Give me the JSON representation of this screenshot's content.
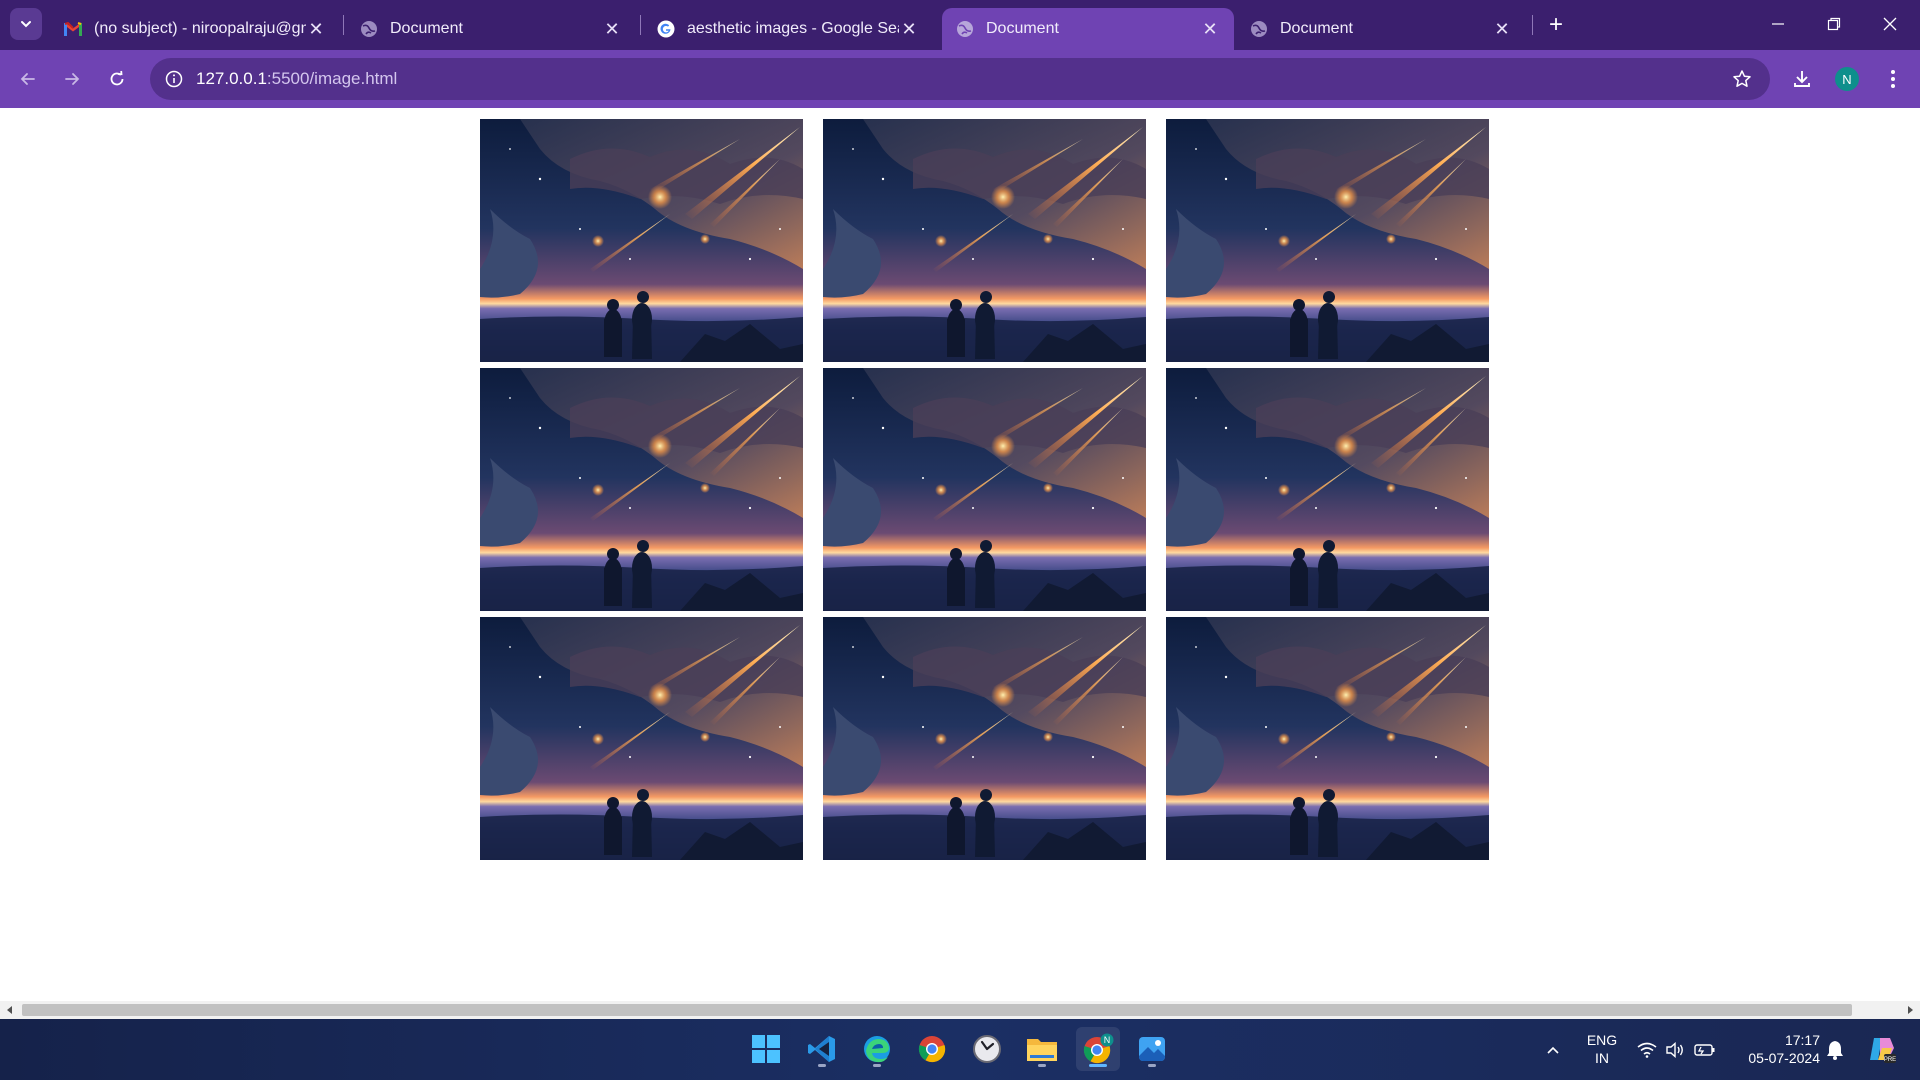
{
  "browser": {
    "tabs": [
      {
        "title": "(no subject) - niroopalraju@gm",
        "icon": "gmail-icon",
        "active": false
      },
      {
        "title": "Document",
        "icon": "globe-icon",
        "active": false
      },
      {
        "title": "aesthetic images - Google Sear",
        "icon": "google-icon",
        "active": false
      },
      {
        "title": "Document",
        "icon": "globe-icon",
        "active": true
      },
      {
        "title": "Document",
        "icon": "globe-icon",
        "active": false
      }
    ],
    "new_tab_glyph": "+",
    "close_glyph": "✕",
    "url_host": "127.0.0.1",
    "url_path": ":5500/image.html",
    "avatar_letter": "N",
    "accent_color": "#6f43b3",
    "frame_color": "#3b1f6e"
  },
  "page": {
    "image_count": 9,
    "image_subject": "two figures watching a meteor shower over the sea at sunset"
  },
  "taskbar": {
    "apps": [
      "windows-start-icon",
      "vscode-icon",
      "edge-icon",
      "chrome-icon",
      "clock-app-icon",
      "file-explorer-icon",
      "chrome-profile-icon",
      "photos-icon"
    ],
    "language_line1": "ENG",
    "language_line2": "IN",
    "time": "17:17",
    "date": "05-07-2024",
    "profile_badge": "N"
  }
}
